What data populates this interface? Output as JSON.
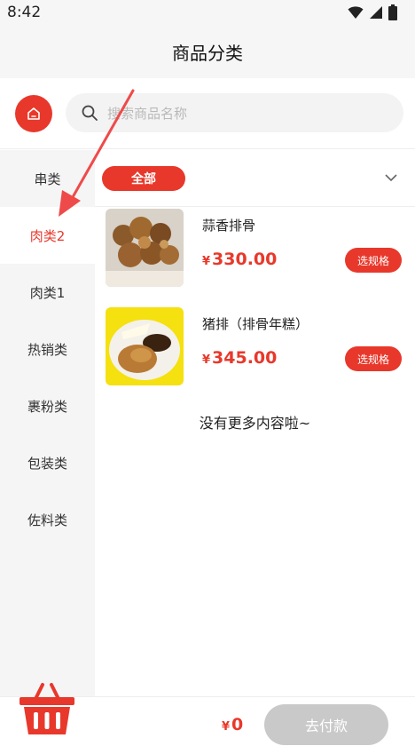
{
  "status_bar": {
    "time": "8:42"
  },
  "header": {
    "title": "商品分类"
  },
  "search": {
    "placeholder": "搜索商品名称"
  },
  "sidebar": {
    "items": [
      {
        "label": "串类",
        "active": false
      },
      {
        "label": "肉类2",
        "active": true
      },
      {
        "label": "肉类1",
        "active": false
      },
      {
        "label": "热销类",
        "active": false
      },
      {
        "label": "裹粉类",
        "active": false
      },
      {
        "label": "包装类",
        "active": false
      },
      {
        "label": "佐料类",
        "active": false
      }
    ]
  },
  "filter": {
    "all_label": "全部"
  },
  "products": [
    {
      "name": "蒜香排骨",
      "currency": "¥",
      "price": "330.00",
      "spec_label": "选规格"
    },
    {
      "name": "猪排（排骨年糕）",
      "currency": "¥",
      "price": "345.00",
      "spec_label": "选规格"
    }
  ],
  "list_footer": {
    "no_more": "没有更多内容啦~"
  },
  "cart": {
    "currency": "¥",
    "total": "0",
    "pay_label": "去付款"
  },
  "colors": {
    "accent": "#e8382b",
    "disabled_button": "#c9c9c9",
    "sidebar_bg": "#f5f5f5"
  }
}
